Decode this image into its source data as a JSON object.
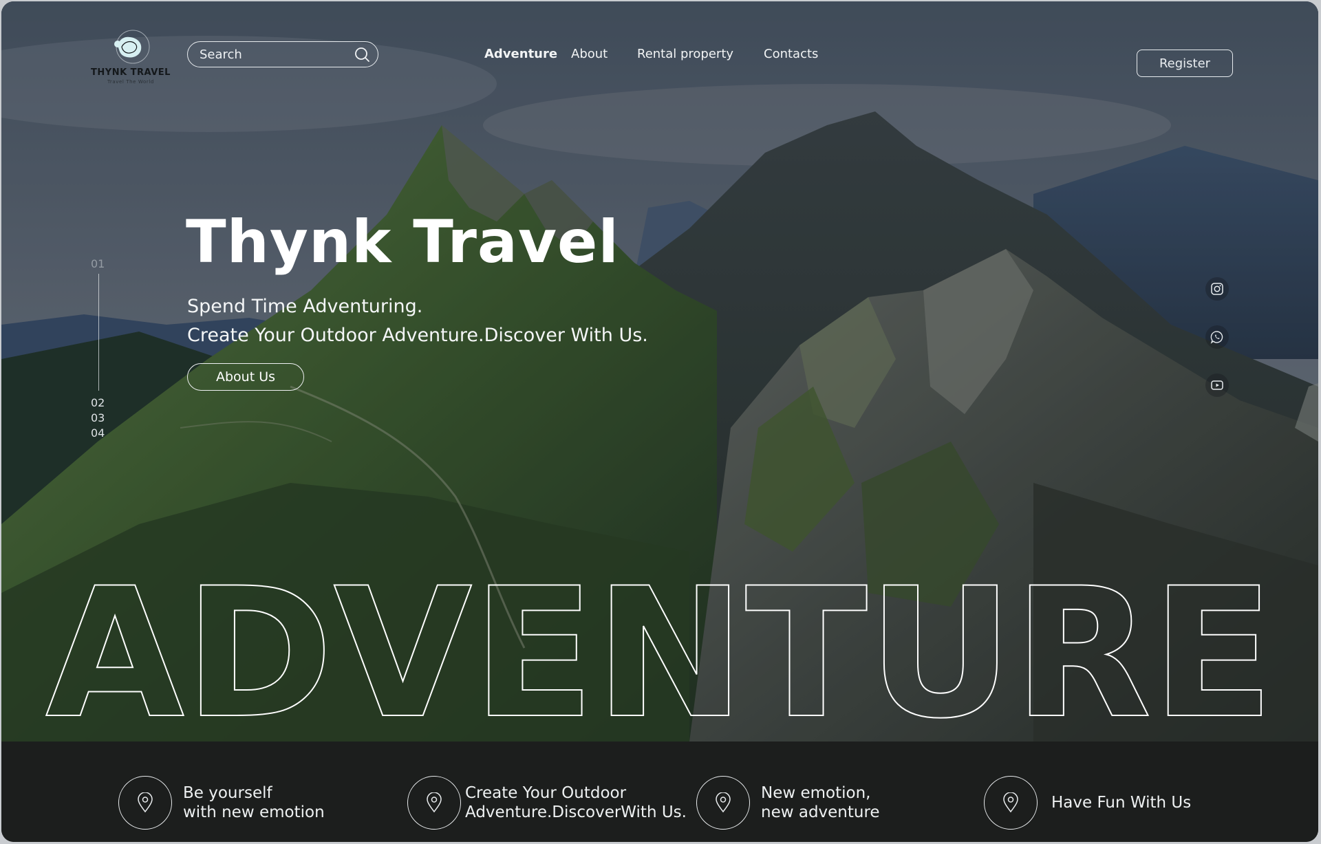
{
  "brand": {
    "name": "THYNK TRAVEL",
    "tagline": "Travel The World"
  },
  "search": {
    "placeholder": "Search",
    "icon": "search-icon"
  },
  "nav": {
    "items": [
      {
        "label": "Adventure",
        "active": true
      },
      {
        "label": "About",
        "active": false
      },
      {
        "label": "Rental property",
        "active": false
      },
      {
        "label": "Contacts",
        "active": false
      }
    ]
  },
  "header": {
    "register_label": "Register"
  },
  "hero": {
    "title": "Thynk Travel",
    "subtitle_line1": "Spend Time Adventuring.",
    "subtitle_line2": "Create Your Outdoor Adventure.Discover With Us.",
    "cta_label": "About Us",
    "big_word": "ADVENTURE"
  },
  "pager": {
    "slides": [
      "01",
      "02",
      "03",
      "04"
    ],
    "current": "01"
  },
  "social": [
    "instagram-icon",
    "whatsapp-icon",
    "youtube-icon"
  ],
  "features": [
    {
      "line1": "Be yourself",
      "line2": "with new emotion"
    },
    {
      "line1": "Create Your Outdoor",
      "line2": "Adventure.DiscoverWith Us."
    },
    {
      "line1": "New emotion,",
      "line2": "new adventure"
    },
    {
      "line1": "Have Fun With Us",
      "line2": ""
    }
  ],
  "colors": {
    "text_light": "#ffffff",
    "footer_bg": "#1c1e1d",
    "mountain_green": "#3b5a32",
    "rock_grey": "#4f5552"
  }
}
